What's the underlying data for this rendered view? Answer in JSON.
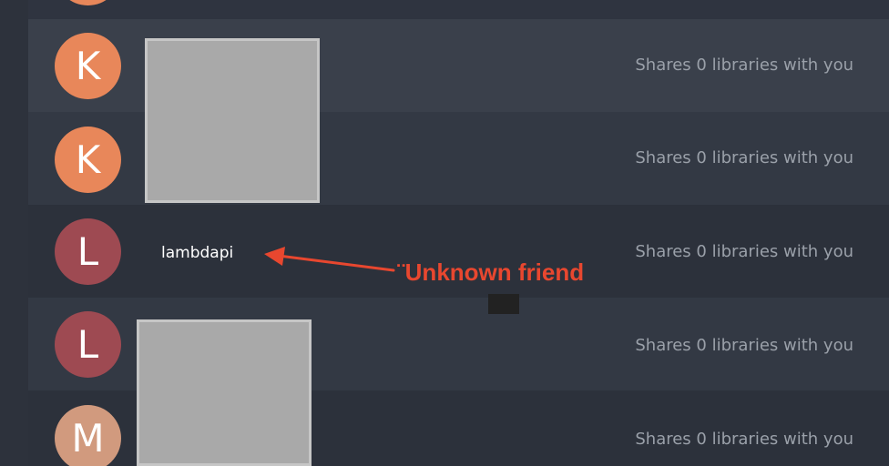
{
  "friends": [
    {
      "initial": "",
      "color": "#e8875a",
      "name": "",
      "share_text": ""
    },
    {
      "initial": "K",
      "color": "#e8875a",
      "name": "",
      "share_text": "Shares 0 libraries with you"
    },
    {
      "initial": "K",
      "color": "#e8875a",
      "name": "",
      "share_text": "Shares 0 libraries with you"
    },
    {
      "initial": "L",
      "color": "#9e4a52",
      "name": "lambdapi",
      "share_text": "Shares 0 libraries with you"
    },
    {
      "initial": "L",
      "color": "#9e4a52",
      "name": "",
      "share_text": "Shares 0 libraries with you"
    },
    {
      "initial": "M",
      "color": "#d19a7e",
      "name": "",
      "share_text": "Shares 0 libraries with you"
    }
  ],
  "annotation": {
    "label": "¨Unknown friend",
    "color": "#e8472f"
  },
  "colors": {
    "redaction_fill": "#a9a9a9",
    "muted_text": "#9aa0a9"
  }
}
